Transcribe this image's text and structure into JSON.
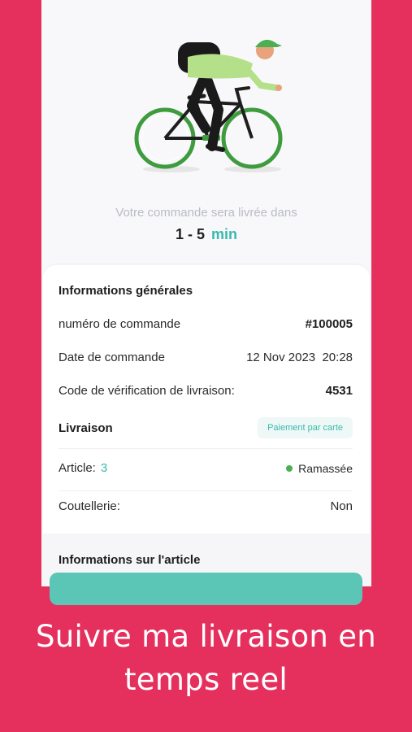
{
  "delivery": {
    "eta_caption": "Votre commande sera livrée dans",
    "eta_range": "1 - 5",
    "eta_unit": "min"
  },
  "general": {
    "title": "Informations générales",
    "order_number_label": "numéro de commande",
    "order_number_value": "#100005",
    "order_date_label": "Date de commande",
    "order_date_value": "12 Nov 2023  20:28",
    "verification_label": "Code de vérification de livraison:",
    "verification_value": "4531"
  },
  "shipping": {
    "title": "Livraison",
    "payment_badge": "Paiement par carte",
    "article_label": "Article:",
    "article_count": "3",
    "status_label": "Ramassée",
    "cutlery_label": "Coutellerie:",
    "cutlery_value": "Non"
  },
  "article_section": {
    "title": "Informations sur l'article"
  },
  "promo": {
    "line1": "Suivre ma livraison en",
    "line2": "temps reel"
  },
  "colors": {
    "brand": "#E5305E",
    "accent": "#3BB9AE",
    "button": "#5BC5B6",
    "status_dot": "#4CAF50"
  },
  "icons": {
    "illustration": "cyclist-illustration",
    "status": "status-dot-icon"
  }
}
